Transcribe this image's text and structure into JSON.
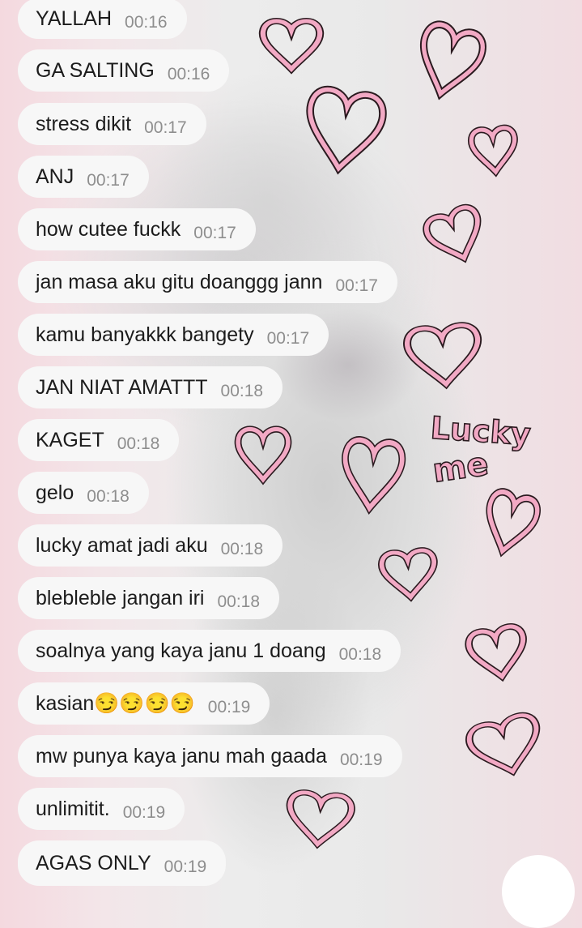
{
  "messages": [
    {
      "text": "YALLAH",
      "time": "00:16"
    },
    {
      "text": "GA SALTING",
      "time": "00:16"
    },
    {
      "text": "stress dikit",
      "time": "00:17"
    },
    {
      "text": "ANJ",
      "time": "00:17"
    },
    {
      "text": "how cutee fuckk",
      "time": "00:17"
    },
    {
      "text": "jan masa aku gitu doanggg jann",
      "time": "00:17"
    },
    {
      "text": "kamu banyakkk bangety",
      "time": "00:17"
    },
    {
      "text": "JAN NIAT AMATTT",
      "time": "00:18"
    },
    {
      "text": "KAGET",
      "time": "00:18"
    },
    {
      "text": "gelo",
      "time": "00:18"
    },
    {
      "text": "lucky amat jadi aku",
      "time": "00:18"
    },
    {
      "text": "blebleble jangan iri",
      "time": "00:18"
    },
    {
      "text": "soalnya yang kaya janu 1 doang",
      "time": "00:18"
    },
    {
      "text": "kasian😏😏😏😏",
      "time": "00:19"
    },
    {
      "text": "mw punya kaya janu mah gaada",
      "time": "00:19"
    },
    {
      "text": "unlimitit.",
      "time": "00:19"
    },
    {
      "text": "AGAS ONLY",
      "time": "00:19"
    }
  ],
  "doodle_text": {
    "line1": "Lucky",
    "line2": "me"
  },
  "colors": {
    "bubble": "#f7f7f7",
    "heart_outline": "#2a1a1f",
    "heart_fill": "#f2a9c4",
    "time": "#8e8e8e"
  }
}
